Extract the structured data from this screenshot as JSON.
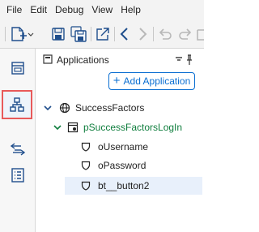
{
  "menu": [
    "File",
    "Edit",
    "Debug",
    "View",
    "Help"
  ],
  "panel": {
    "title": "Applications",
    "add_button_label": "Add Application"
  },
  "tree": {
    "app": "SuccessFactors",
    "page": "pSuccessFactorsLogIn",
    "items": [
      "oUsername",
      "oPassword",
      "bt__button2"
    ]
  },
  "colors": {
    "accent": "#0a6ed1",
    "page_green": "#107e3e",
    "highlight_border": "#e85a5a"
  }
}
